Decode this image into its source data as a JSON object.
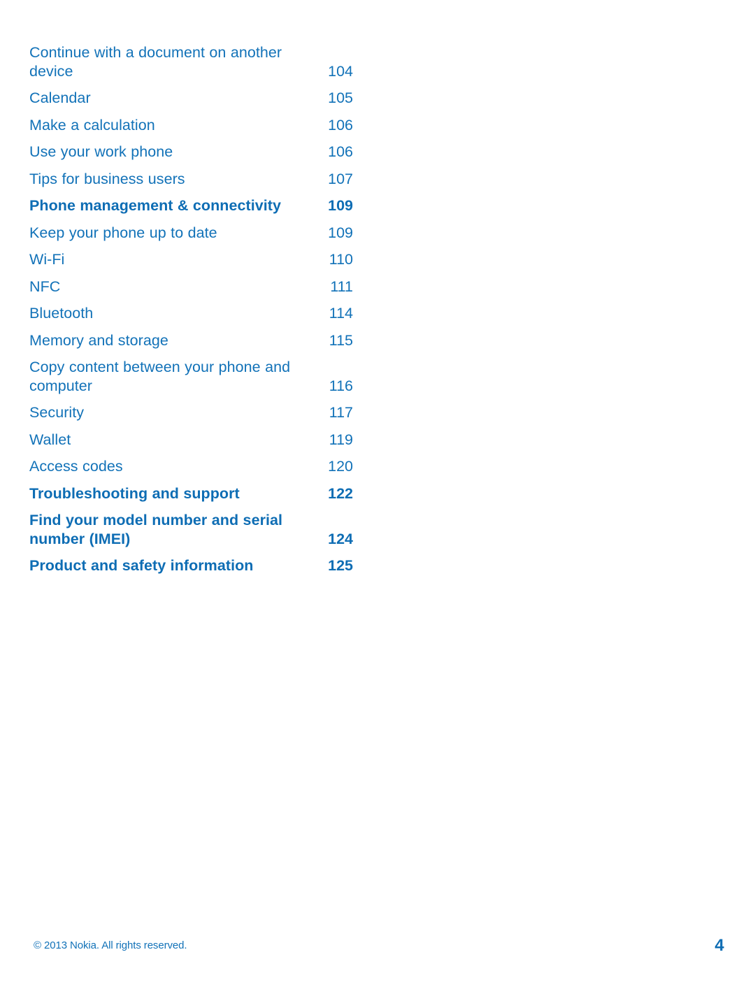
{
  "document": {
    "type": "table-of-contents",
    "page_label": "4",
    "text_color": "#1272b8",
    "heading_color": "#0e6db4",
    "background_color": "#ffffff"
  },
  "toc": {
    "entries": [
      {
        "title": "Continue with a document on another device",
        "page": "104",
        "bold": false
      },
      {
        "title": "Calendar",
        "page": "105",
        "bold": false
      },
      {
        "title": "Make a calculation",
        "page": "106",
        "bold": false
      },
      {
        "title": "Use your work phone",
        "page": "106",
        "bold": false
      },
      {
        "title": "Tips for business users",
        "page": "107",
        "bold": false
      },
      {
        "title": "Phone management & connectivity",
        "page": "109",
        "bold": true
      },
      {
        "title": "Keep your phone up to date",
        "page": "109",
        "bold": false
      },
      {
        "title": "Wi-Fi",
        "page": "110",
        "bold": false
      },
      {
        "title": "NFC",
        "page": "111",
        "bold": false
      },
      {
        "title": "Bluetooth",
        "page": "114",
        "bold": false
      },
      {
        "title": "Memory and storage",
        "page": "115",
        "bold": false
      },
      {
        "title": "Copy content between your phone and computer",
        "page": "116",
        "bold": false
      },
      {
        "title": "Security",
        "page": "117",
        "bold": false
      },
      {
        "title": "Wallet",
        "page": "119",
        "bold": false
      },
      {
        "title": "Access codes",
        "page": "120",
        "bold": false
      },
      {
        "title": "Troubleshooting and support",
        "page": "122",
        "bold": true
      },
      {
        "title": "Find your model number and serial number (IMEI)",
        "page": "124",
        "bold": true
      },
      {
        "title": "Product and safety information",
        "page": "125",
        "bold": true
      }
    ]
  },
  "footer": {
    "copyright": "© 2013 Nokia. All rights reserved.",
    "page_number": "4"
  }
}
